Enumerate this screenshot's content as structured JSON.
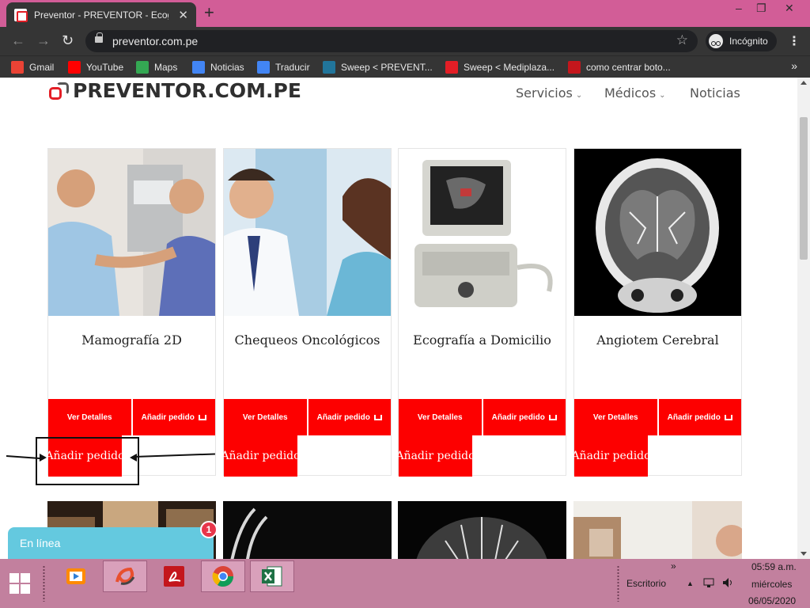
{
  "browser": {
    "tab_title": "Preventor - PREVENTOR - Ecogra",
    "tab_close": "✕",
    "new_tab": "+",
    "win_min": "–",
    "win_restore": "❐",
    "win_close": "✕",
    "back": "←",
    "forward": "→",
    "reload": "↻",
    "url": "preventor.com.pe",
    "star": "☆",
    "incognito_label": "Incógnito",
    "menu": "⋮",
    "bookmarks": [
      {
        "label": "Gmail",
        "color": "#ea4335"
      },
      {
        "label": "YouTube",
        "color": "#ff0000"
      },
      {
        "label": "Maps",
        "color": "#34a853"
      },
      {
        "label": "Noticias",
        "color": "#4285f4"
      },
      {
        "label": "Traducir",
        "color": "#4285f4"
      },
      {
        "label": "Sweep < PREVENT...",
        "color": "#21759b"
      },
      {
        "label": "Sweep < Mediplaza...",
        "color": "#e41e26"
      },
      {
        "label": "como centrar boto...",
        "color": "#c4161c"
      }
    ],
    "bookmarks_more": "»"
  },
  "site": {
    "logo_text": "PREVENTOR.COM.PE",
    "nav": [
      {
        "label": "Servicios",
        "has_dropdown": true
      },
      {
        "label": "Médicos",
        "has_dropdown": true
      },
      {
        "label": "Noticias",
        "has_dropdown": false
      }
    ],
    "chevron": "⌄",
    "accent": "#fd0000",
    "products": [
      {
        "title": "Mamografía 2D",
        "detail_label": "Ver Detalles",
        "add_label": "Añadir pedido",
        "add_big_label": "Añadir pedido"
      },
      {
        "title": "Chequeos Oncológicos",
        "detail_label": "Ver Detalles",
        "add_label": "Añadir pedido",
        "add_big_label": "Añadir pedido"
      },
      {
        "title": "Ecografía a Domicilio",
        "detail_label": "Ver Detalles",
        "add_label": "Añadir pedido",
        "add_big_label": "Añadir pedido"
      },
      {
        "title": "Angiotem Cerebral",
        "detail_label": "Ver Detalles",
        "add_label": "Añadir pedido",
        "add_big_label": "Añadir pedido"
      }
    ],
    "chat_label": "En línea",
    "chat_badge": "1"
  },
  "taskbar": {
    "desktop_label": "Escritorio",
    "tray_more": "»",
    "tray_caret": "▲",
    "time": "05:59 a.m.",
    "day": "miércoles",
    "date": "06/05/2020",
    "apps": [
      {
        "name": "media-player",
        "color": "#ff8a00"
      },
      {
        "name": "app-swirl",
        "color": "#e84f2e"
      },
      {
        "name": "acrobat",
        "color": "#c4161c"
      },
      {
        "name": "chrome",
        "color": "#4285f4"
      },
      {
        "name": "excel",
        "color": "#1e7145"
      }
    ]
  }
}
